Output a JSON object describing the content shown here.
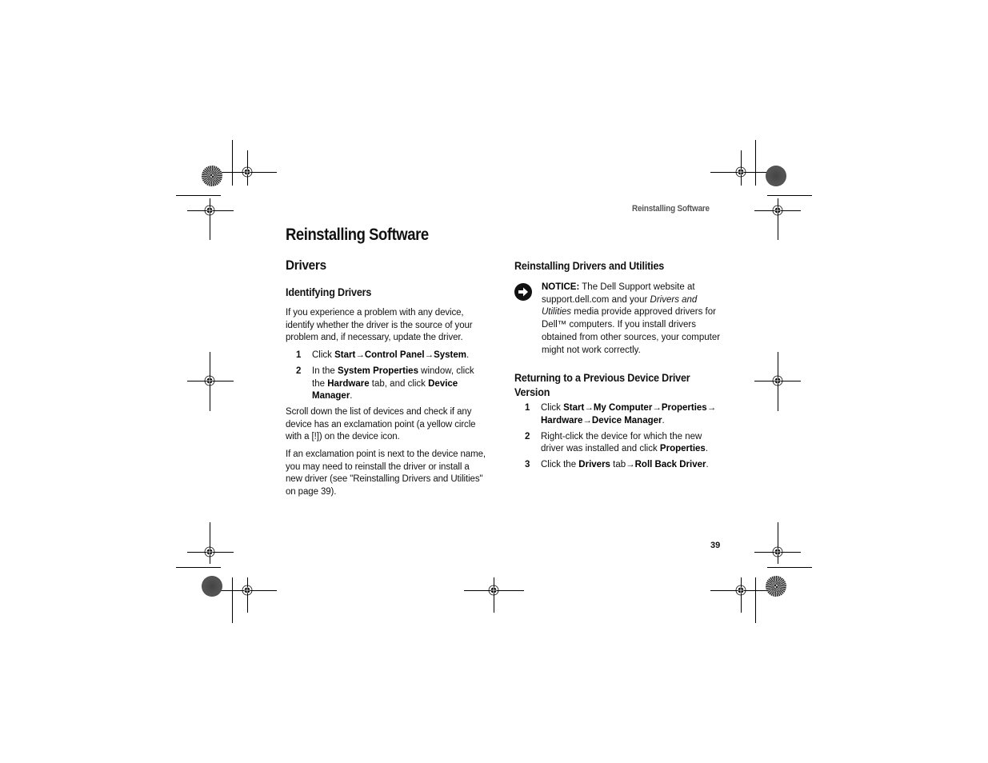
{
  "running_header": "Reinstalling Software",
  "page_title": "Reinstalling Software",
  "page_number": "39",
  "left_column": {
    "section_heading": "Drivers",
    "subsection_heading": "Identifying Drivers",
    "intro": "If you experience a problem with any device, identify whether the driver is the source of your problem and, if necessary, update the driver.",
    "steps": [
      {
        "num": "1",
        "parts": [
          [
            "Click ",
            ""
          ],
          [
            "Start",
            "b"
          ],
          [
            "→",
            ""
          ],
          [
            "Control Panel",
            "b"
          ],
          [
            "→",
            ""
          ],
          [
            "System",
            "b"
          ],
          [
            ".",
            ""
          ]
        ]
      },
      {
        "num": "2",
        "parts": [
          [
            "In the ",
            ""
          ],
          [
            "System Properties",
            "b"
          ],
          [
            " window, click the ",
            ""
          ],
          [
            "Hardware",
            "b"
          ],
          [
            " tab, and click ",
            ""
          ],
          [
            "Device Manager",
            "b"
          ],
          [
            ".",
            ""
          ]
        ]
      }
    ],
    "para2": "Scroll down the list of devices and check if any device has an exclamation point (a yellow circle with a [!]) on the device icon.",
    "para3": "If an exclamation point is next to the device name, you may need to reinstall the driver or install a new driver (see \"Reinstalling Drivers and Utilities\" on page 39)."
  },
  "right_column": {
    "section_heading": "Reinstalling Drivers and Utilities",
    "notice": {
      "icon": "notice-arrow-icon",
      "parts": [
        [
          "NOTICE:",
          "b"
        ],
        [
          " The Dell Support website at support.dell.com and your ",
          ""
        ],
        [
          "Drivers and Utilities",
          "i"
        ],
        [
          " media provide approved drivers for Dell™ computers. If you install drivers obtained from other sources, your computer might not work correctly.",
          ""
        ]
      ]
    },
    "subsection_heading": "Returning to a Previous Device Driver Version",
    "steps": [
      {
        "num": "1",
        "parts": [
          [
            "Click ",
            ""
          ],
          [
            "Start",
            "b"
          ],
          [
            "→",
            ""
          ],
          [
            "My Computer",
            "b"
          ],
          [
            "→",
            ""
          ],
          [
            "Properties",
            "b"
          ],
          [
            "→ ",
            ""
          ],
          [
            "Hardware",
            "b"
          ],
          [
            "→",
            ""
          ],
          [
            "Device Manager",
            "b"
          ],
          [
            ".",
            ""
          ]
        ]
      },
      {
        "num": "2",
        "parts": [
          [
            "Right-click the device for which the new driver was installed and click ",
            ""
          ],
          [
            "Properties",
            "b"
          ],
          [
            ".",
            ""
          ]
        ]
      },
      {
        "num": "3",
        "parts": [
          [
            "Click the ",
            ""
          ],
          [
            "Drivers",
            "b"
          ],
          [
            " tab",
            ""
          ],
          [
            "→",
            ""
          ],
          [
            "Roll Back Driver",
            "b"
          ],
          [
            ".",
            ""
          ]
        ]
      }
    ]
  }
}
